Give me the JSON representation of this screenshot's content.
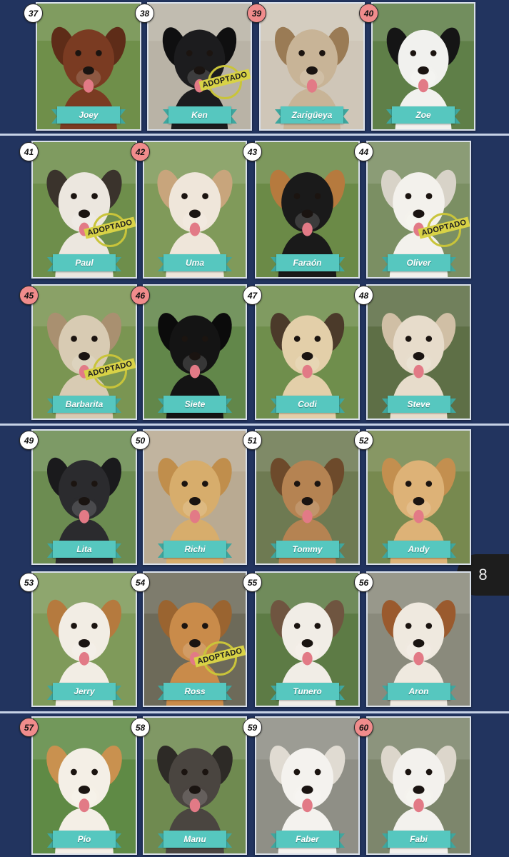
{
  "adopted_label": "ADOPTADO",
  "page_indicator": "8",
  "colors": {
    "background": "#22345f",
    "ribbon": "#56c7bf",
    "number_white": "#ffffff",
    "number_pink": "#f08c8c",
    "stamp": "#d8d246"
  },
  "dogs": [
    {
      "number": "37",
      "name": "Joey",
      "badge": "white",
      "adopted": false,
      "coat": "#7a3b22",
      "ear": "#5e2c18",
      "bg": "#6f8f4a"
    },
    {
      "number": "38",
      "name": "Ken",
      "badge": "white",
      "adopted": true,
      "coat": "#1c1c1e",
      "ear": "#0f0f10",
      "bg": "#b9b3a6"
    },
    {
      "number": "39",
      "name": "Zarigüeya",
      "badge": "pink",
      "adopted": false,
      "coat": "#c8b497",
      "ear": "#9a7b55",
      "bg": "#cfc6b8"
    },
    {
      "number": "40",
      "name": "Zoe",
      "badge": "pink",
      "adopted": false,
      "coat": "#f1f1ee",
      "ear": "#151515",
      "bg": "#5f7f48"
    },
    {
      "number": "41",
      "name": "Paul",
      "badge": "white",
      "adopted": true,
      "coat": "#ece7df",
      "ear": "#3a332c",
      "bg": "#6e8e4b"
    },
    {
      "number": "42",
      "name": "Uma",
      "badge": "pink",
      "adopted": false,
      "coat": "#efe6da",
      "ear": "#c8a57c",
      "bg": "#809a5a"
    },
    {
      "number": "43",
      "name": "Faraón",
      "badge": "white",
      "adopted": false,
      "coat": "#1a1a1a",
      "ear": "#b67a3e",
      "bg": "#6b8a47"
    },
    {
      "number": "44",
      "name": "Oliver",
      "badge": "white",
      "adopted": true,
      "coat": "#f3f1ec",
      "ear": "#d8d3c8",
      "bg": "#7b8f63"
    },
    {
      "number": "45",
      "name": "Barbarita",
      "badge": "pink",
      "adopted": true,
      "coat": "#d8cbb3",
      "ear": "#a99070",
      "bg": "#7a9552"
    },
    {
      "number": "46",
      "name": "Siete",
      "badge": "pink",
      "adopted": false,
      "coat": "#141414",
      "ear": "#0b0b0b",
      "bg": "#62874a"
    },
    {
      "number": "47",
      "name": "Codi",
      "badge": "white",
      "adopted": false,
      "coat": "#e3cfa9",
      "ear": "#4b3a2a",
      "bg": "#6f8e4c"
    },
    {
      "number": "48",
      "name": "Steve",
      "badge": "white",
      "adopted": false,
      "coat": "#e7dccb",
      "ear": "#d0bfa5",
      "bg": "#5e6f46"
    },
    {
      "number": "49",
      "name": "Lita",
      "badge": "white",
      "adopted": false,
      "coat": "#2b2b2e",
      "ear": "#1a1a1c",
      "bg": "#6c8c51"
    },
    {
      "number": "50",
      "name": "Richi",
      "badge": "white",
      "adopted": false,
      "coat": "#d7ad6c",
      "ear": "#c08e4c",
      "bg": "#b9aa92"
    },
    {
      "number": "51",
      "name": "Tommy",
      "badge": "white",
      "adopted": false,
      "coat": "#b58352",
      "ear": "#6d4a2b",
      "bg": "#6e7a52"
    },
    {
      "number": "52",
      "name": "Andy",
      "badge": "white",
      "adopted": false,
      "coat": "#ddb277",
      "ear": "#c38f4f",
      "bg": "#77894f"
    },
    {
      "number": "53",
      "name": "Jerry",
      "badge": "white",
      "adopted": false,
      "coat": "#f2ede4",
      "ear": "#b57a3e",
      "bg": "#7f9a5a"
    },
    {
      "number": "54",
      "name": "Ross",
      "badge": "white",
      "adopted": true,
      "coat": "#c98b4a",
      "ear": "#9a6430",
      "bg": "#6d6a59"
    },
    {
      "number": "55",
      "name": "Tunero",
      "badge": "white",
      "adopted": false,
      "coat": "#f1ede6",
      "ear": "#6f5540",
      "bg": "#5d7b45"
    },
    {
      "number": "56",
      "name": "Aron",
      "badge": "white",
      "adopted": false,
      "coat": "#efe9df",
      "ear": "#9a5a2e",
      "bg": "#8a8a7c"
    },
    {
      "number": "57",
      "name": "Pío",
      "badge": "pink",
      "adopted": false,
      "coat": "#f4efe6",
      "ear": "#c9914f",
      "bg": "#5f8a45"
    },
    {
      "number": "58",
      "name": "Manu",
      "badge": "white",
      "adopted": false,
      "coat": "#4a4540",
      "ear": "#2d2a26",
      "bg": "#6f8a50"
    },
    {
      "number": "59",
      "name": "Faber",
      "badge": "white",
      "adopted": false,
      "coat": "#f4f2ee",
      "ear": "#e0dbd2",
      "bg": "#8f8f86"
    },
    {
      "number": "60",
      "name": "Fabi",
      "badge": "pink",
      "adopted": false,
      "coat": "#f3f1ed",
      "ear": "#dcd6cb",
      "bg": "#7d866c"
    }
  ]
}
